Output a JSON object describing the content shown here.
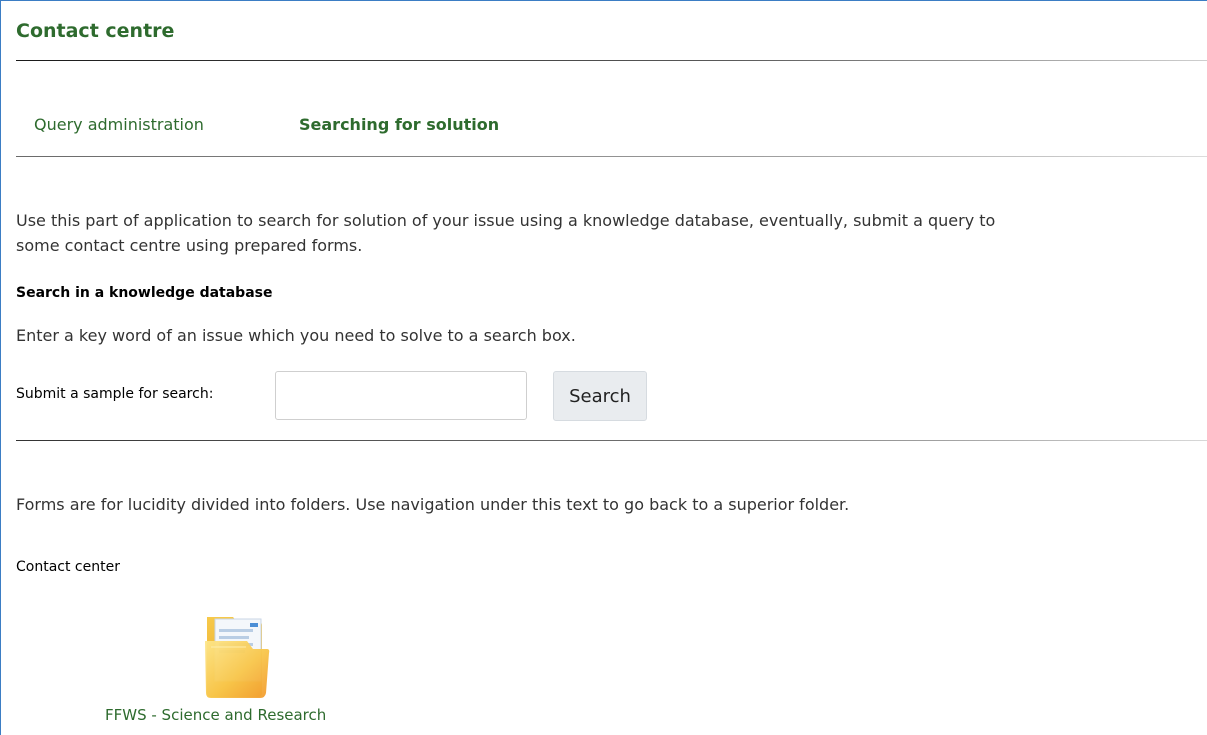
{
  "header": {
    "title": "Contact centre"
  },
  "tabs": [
    {
      "label": "Query administration",
      "active": false
    },
    {
      "label": "Searching for solution",
      "active": true
    }
  ],
  "intro": {
    "line1": "Use this part of application to search for solution of your issue using a knowledge database, eventually, submit a query to",
    "line2": "some contact centre using prepared forms."
  },
  "knowledge_search": {
    "heading": "Search in a knowledge database",
    "hint": "Enter a key word of an issue which you need to solve to a search box.",
    "label": "Submit a sample for search:",
    "input_value": "",
    "button_label": "Search"
  },
  "forms": {
    "description": "Forms are for lucidity divided into folders. Use navigation under this text to go back to a superior folder.",
    "breadcrumb": "Contact center",
    "folders": [
      {
        "label": "FFWS - Science and Research",
        "icon": "folder-icon"
      }
    ]
  },
  "colors": {
    "link_green": "#2e6b2e",
    "frame_blue": "#3b7dc4",
    "button_bg": "#e9ecef",
    "folder_yellow": "#f6c63a"
  }
}
